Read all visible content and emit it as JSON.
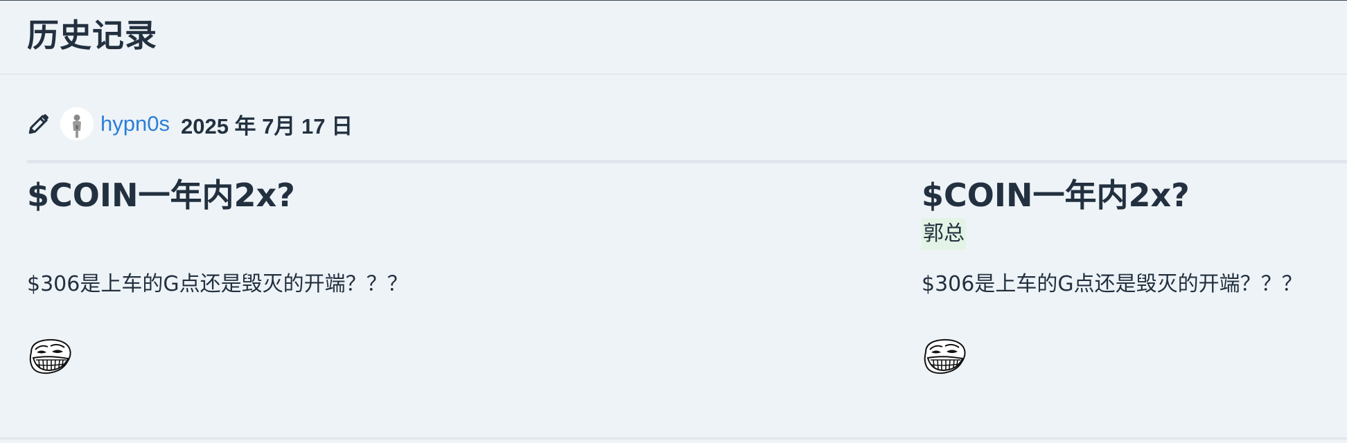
{
  "header": {
    "title": "历史记录"
  },
  "revision": {
    "edit_icon": "pencil-icon",
    "author": "hypn0s",
    "date": "2025 年 7月 17 日"
  },
  "left": {
    "title": "$COIN一年内2x?",
    "body": "$306是上车的G点还是毁灭的开端？？？",
    "emoji": "trollface-emoji"
  },
  "right": {
    "title": "$COIN一年内2x?",
    "added": "郭总",
    "body": "$306是上车的G点还是毁灭的开端？？？",
    "emoji": "trollface-emoji"
  },
  "colors": {
    "background": "#eef3f7",
    "link": "#2b7fd8",
    "text": "#22303f",
    "added_highlight": "#e3f4e6"
  }
}
